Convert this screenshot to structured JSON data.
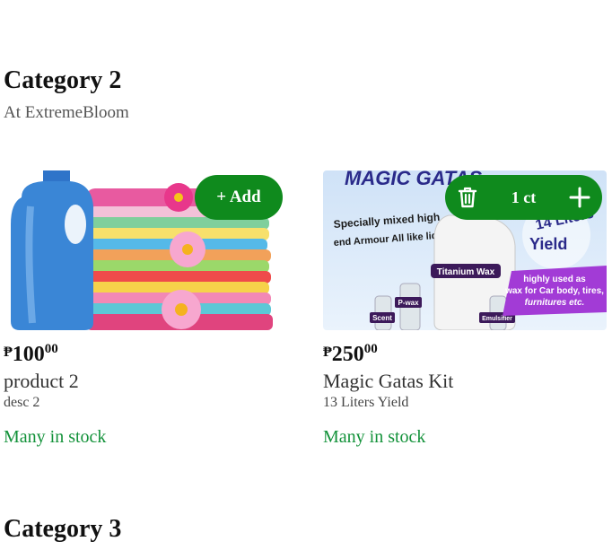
{
  "categories": [
    {
      "title": "Category 2",
      "subtitle": "At ExtremeBloom"
    },
    {
      "title": "Category 3"
    }
  ],
  "products": [
    {
      "currency": "₱",
      "price_whole": "100",
      "price_cents": "00",
      "name": "product 2",
      "desc": "desc 2",
      "stock": "Many in stock",
      "action": {
        "add_label": "+ Add"
      }
    },
    {
      "currency": "₱",
      "price_whole": "250",
      "price_cents": "00",
      "name": "Magic Gatas Kit",
      "desc": "13 Liters Yield",
      "stock": "Many in stock",
      "cart": {
        "qty_label": "1 ct"
      },
      "image_text": {
        "headline": "MAGIC GATAS",
        "line1": "Specially mixed high",
        "line2": "end Armour All like liquid",
        "yield_a": "14 Liters",
        "yield_b": "Yield",
        "tag_main": "Titanium Wax",
        "tag_pwax": "P-wax",
        "tag_scent": "Scent",
        "tag_emul": "Emulsifier",
        "usage_1": "highly used as",
        "usage_2": "wax for Car body, tires,",
        "usage_3": "furnitures etc."
      }
    }
  ],
  "colors": {
    "accent_green": "#0f8a1d",
    "stock_green": "#13923a"
  },
  "icons": {
    "trash": "trash-icon",
    "plus": "plus-icon"
  }
}
